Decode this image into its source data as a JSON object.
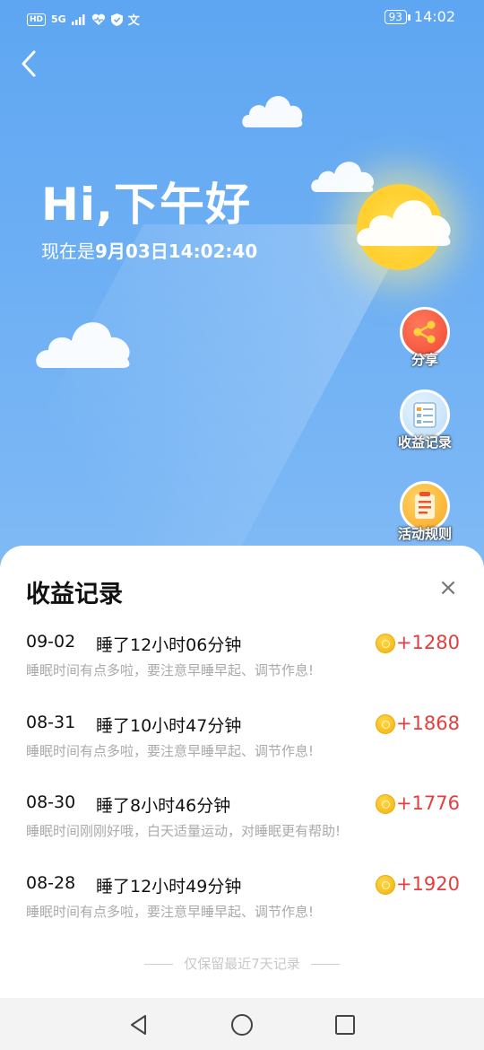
{
  "status_bar": {
    "network": "5G",
    "battery": "93",
    "time": "14:02"
  },
  "header": {
    "greeting": "Hi,下午好",
    "time_prefix": "现在是",
    "datetime": "9月03日14:02:40"
  },
  "side_buttons": [
    {
      "label": "分享",
      "icon": "share-icon"
    },
    {
      "label": "收益记录",
      "icon": "record-icon"
    },
    {
      "label": "活动规则",
      "icon": "rules-icon"
    }
  ],
  "sheet": {
    "title": "收益记录",
    "close_label": "×",
    "records": [
      {
        "date": "09-02",
        "duration": "睡了12小时06分钟",
        "points": "+1280",
        "note": "睡眠时间有点多啦，要注意早睡早起、调节作息!"
      },
      {
        "date": "08-31",
        "duration": "睡了10小时47分钟",
        "points": "+1868",
        "note": "睡眠时间有点多啦，要注意早睡早起、调节作息!"
      },
      {
        "date": "08-30",
        "duration": "睡了8小时46分钟",
        "points": "+1776",
        "note": "睡眠时间刚刚好哦，白天适量运动，对睡眠更有帮助!"
      },
      {
        "date": "08-28",
        "duration": "睡了12小时49分钟",
        "points": "+1920",
        "note": "睡眠时间有点多啦，要注意早睡早起、调节作息!"
      }
    ],
    "footer_note": "仅保留最近7天记录"
  },
  "colors": {
    "sky_top": "#5ea6f2",
    "points_red": "#e53d3d",
    "coin_gold": "#f3b10c"
  }
}
